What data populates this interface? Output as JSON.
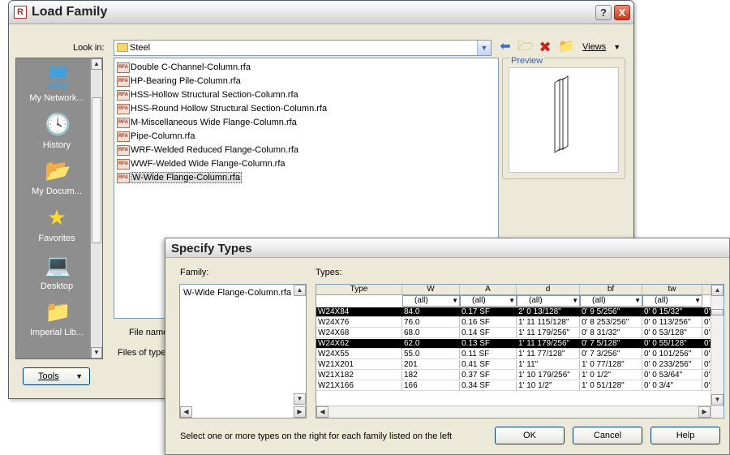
{
  "load_family": {
    "title": "Load Family",
    "help_btn": "?",
    "close_btn": "X",
    "look_in_label": "Look in:",
    "look_in_value": "Steel",
    "views_label": "Views",
    "places": [
      {
        "label": "My Network..."
      },
      {
        "label": "History"
      },
      {
        "label": "My Docum..."
      },
      {
        "label": "Favorites"
      },
      {
        "label": "Desktop"
      },
      {
        "label": "Imperial Lib..."
      }
    ],
    "files": [
      "Double C-Channel-Column.rfa",
      "HP-Bearing Pile-Column.rfa",
      "HSS-Hollow Structural Section-Column.rfa",
      "HSS-Round Hollow Structural Section-Column.rfa",
      "M-Miscellaneous Wide Flange-Column.rfa",
      "Pipe-Column.rfa",
      "WRF-Welded Reduced Flange-Column.rfa",
      "WWF-Welded Wide Flange-Column.rfa",
      "W-Wide Flange-Column.rfa"
    ],
    "selected_file_index": 8,
    "file_name_label": "File name:",
    "files_of_type_label": "Files of type:",
    "preview_label": "Preview",
    "tools_label": "Tools",
    "file_icon_text": "RFA"
  },
  "specify_types": {
    "title": "Specify Types",
    "family_label": "Family:",
    "types_label": "Types:",
    "family_item": "W-Wide Flange-Column.rfa",
    "columns": [
      "Type",
      "W",
      "A",
      "d",
      "bf",
      "tw",
      ""
    ],
    "filters": [
      "(all)",
      "(all)",
      "(all)",
      "(all)",
      "(all)",
      ""
    ],
    "rows": [
      {
        "selected": true,
        "cells": [
          "W24X84",
          "84.0",
          "0.17 SF",
          "2'  0 13/128\"",
          "0'  9 5/256\"",
          "0'  0 15/32\"",
          "0'"
        ]
      },
      {
        "selected": false,
        "cells": [
          "W24X76",
          "76.0",
          "0.16 SF",
          "1'  11 115/128\"",
          "0'  8 253/256\"",
          "0'  0 113/256\"",
          "0'"
        ]
      },
      {
        "selected": false,
        "cells": [
          "W24X68",
          "68.0",
          "0.14 SF",
          "1'  11 179/256\"",
          "0'  8 31/32\"",
          "0'  0 53/128\"",
          "0'"
        ]
      },
      {
        "selected": true,
        "cells": [
          "W24X62",
          "62.0",
          "0.13 SF",
          "1'  11 179/256\"",
          "0'  7 5/128\"",
          "0'  0 55/128\"",
          "0'"
        ]
      },
      {
        "selected": false,
        "cells": [
          "W24X55",
          "55.0",
          "0.11 SF",
          "1'  11 77/128\"",
          "0'  7 3/256\"",
          "0'  0 101/256\"",
          "0'"
        ]
      },
      {
        "selected": false,
        "cells": [
          "W21X201",
          "201",
          "0.41 SF",
          "1'  11\"",
          "1'  0 77/128\"",
          "0'  0 233/256\"",
          "0'"
        ]
      },
      {
        "selected": false,
        "cells": [
          "W21X182",
          "182",
          "0.37 SF",
          "1'  10 179/256\"",
          "1'  0 1/2\"",
          "0'  0 53/64\"",
          "0'"
        ]
      },
      {
        "selected": false,
        "cells": [
          "W21X166",
          "166",
          "0.34 SF",
          "1'  10 1/2\"",
          "1'  0 51/128\"",
          "0'  0 3/4\"",
          "0'"
        ]
      }
    ],
    "hint": "Select one or more types on the right for each family listed on the left",
    "ok": "OK",
    "cancel": "Cancel",
    "help": "Help"
  }
}
